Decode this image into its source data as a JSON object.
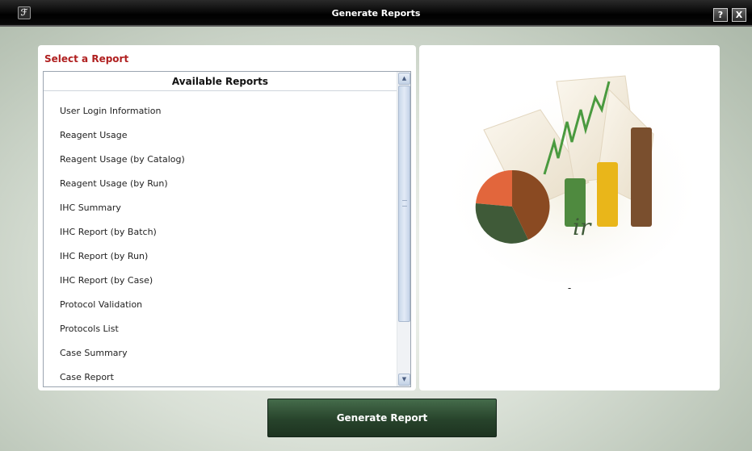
{
  "window": {
    "title": "Generate Reports",
    "help_label": "?",
    "close_label": "X",
    "app_icon": "app-logo-icon"
  },
  "report_panel": {
    "heading": "Select a Report",
    "list_header": "Available Reports",
    "items": [
      "User Login Information",
      "Reagent Usage",
      "Reagent Usage (by Catalog)",
      "Reagent Usage (by Run)",
      "IHC Summary",
      "IHC Report (by Batch)",
      "IHC Report (by Run)",
      "IHC Report (by Case)",
      "Protocol Validation",
      "Protocols List",
      "Case Summary",
      "Case Report"
    ],
    "scroll_position": 0
  },
  "preview_panel": {
    "selected_report": "-",
    "illustration": "report-charts-illustration"
  },
  "actions": {
    "generate_label": "Generate Report"
  },
  "colors": {
    "heading": "#b02020",
    "button": "#27432b",
    "titlebar": "#000000"
  }
}
